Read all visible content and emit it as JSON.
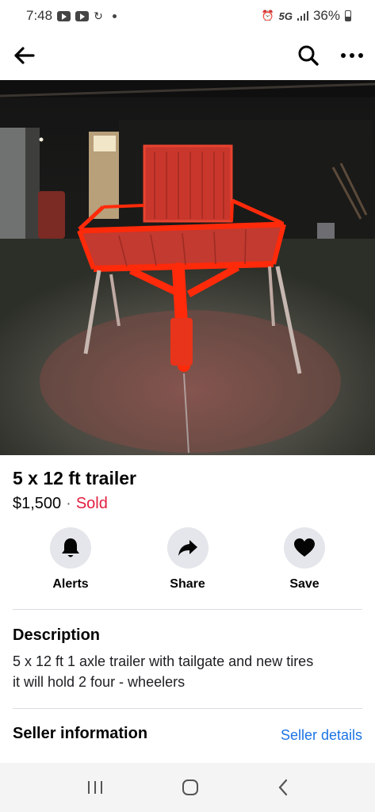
{
  "status_bar": {
    "time": "7:48",
    "network": "5G",
    "battery": "36%"
  },
  "listing": {
    "title": "5 x 12 ft trailer",
    "price": "$1,500",
    "separator": "·",
    "status": "Sold",
    "photo_count": 4,
    "active_photo_index": 0
  },
  "actions": [
    {
      "label": "Alerts",
      "icon": "bell-icon"
    },
    {
      "label": "Share",
      "icon": "share-arrow-icon"
    },
    {
      "label": "Save",
      "icon": "heart-icon"
    }
  ],
  "description": {
    "heading": "Description",
    "text": "5 x 12 ft 1 axle trailer  with tailgate and new tires\nit will hold 2 four - wheelers"
  },
  "seller": {
    "heading": "Seller information",
    "link": "Seller details"
  },
  "colors": {
    "accent": "#1b74e4",
    "sold": "#e41e3f",
    "trailer": "#ff2a0a"
  }
}
